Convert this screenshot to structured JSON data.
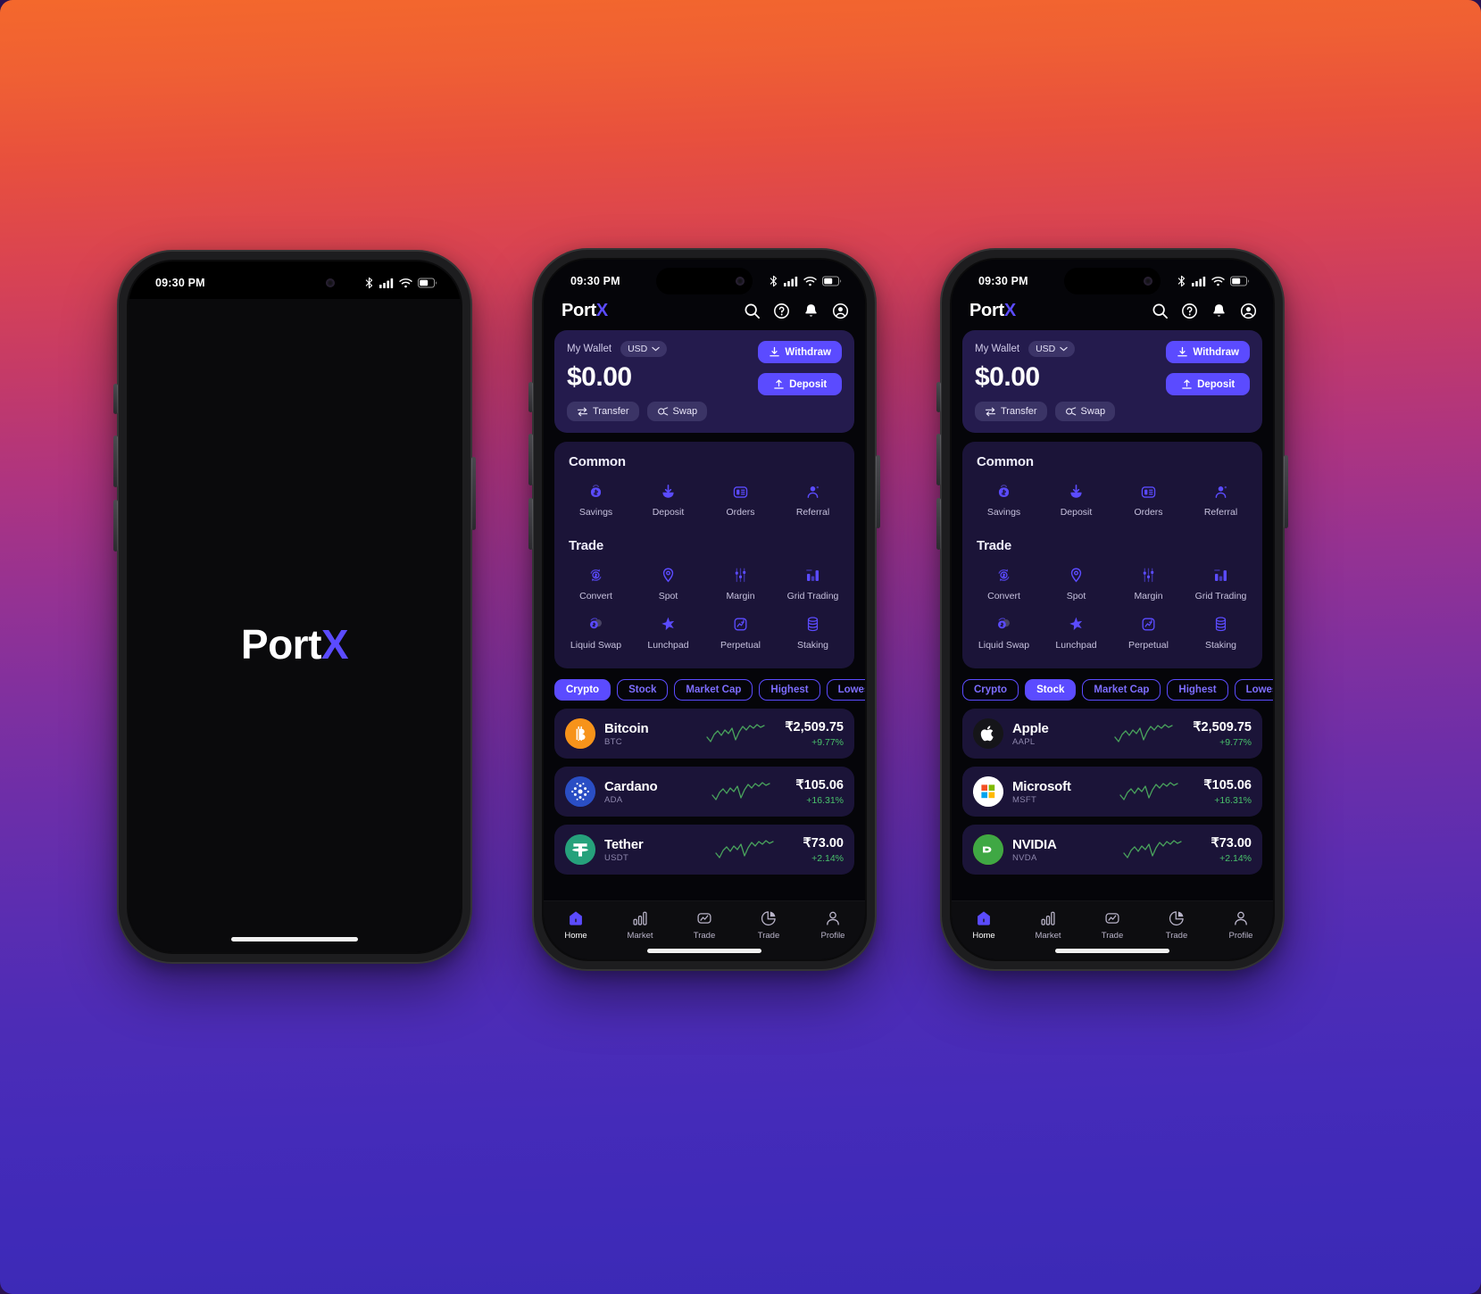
{
  "scene": {
    "background_gradient_top": "#f4682c",
    "background_gradient_mid": "#963292",
    "background_gradient_bottom": "#3b29b5",
    "accent_color": "#5b4bff",
    "card_color": "#1b1438",
    "wallet_card_color": "#241b4d",
    "positive_color": "#49c16b"
  },
  "status_bar": {
    "time": "09:30 PM"
  },
  "splash": {
    "logo_prefix": "Port",
    "logo_accent": "X"
  },
  "header": {
    "logo_prefix": "Port",
    "logo_accent": "X",
    "icons": [
      "search-icon",
      "help-circle-icon",
      "bell-icon",
      "account-circle-icon"
    ]
  },
  "wallet": {
    "label": "My Wallet",
    "currency": "USD",
    "balance": "$0.00",
    "withdraw_label": "Withdraw",
    "deposit_label": "Deposit",
    "transfer_label": "Transfer",
    "swap_label": "Swap"
  },
  "menu": {
    "common_title": "Common",
    "common_items": [
      {
        "label": "Savings",
        "icon": "savings-bag-icon"
      },
      {
        "label": "Deposit",
        "icon": "deposit-arrow-icon"
      },
      {
        "label": "Orders",
        "icon": "orders-receipt-icon"
      },
      {
        "label": "Referral",
        "icon": "referral-person-icon"
      }
    ],
    "trade_title": "Trade",
    "trade_items": [
      {
        "label": "Convert",
        "icon": "convert-refresh-icon"
      },
      {
        "label": "Spot",
        "icon": "spot-pin-icon"
      },
      {
        "label": "Margin",
        "icon": "margin-sliders-icon"
      },
      {
        "label": "Grid Trading",
        "icon": "grid-bars-icon"
      },
      {
        "label": "Liquid Swap",
        "icon": "liquid-swap-icon"
      },
      {
        "label": "Lunchpad",
        "icon": "lunchpad-star-icon"
      },
      {
        "label": "Perpetual",
        "icon": "perpetual-chart-icon"
      },
      {
        "label": "Staking",
        "icon": "staking-coins-icon"
      }
    ]
  },
  "filters_crypto": [
    {
      "label": "Crypto",
      "active": true
    },
    {
      "label": "Stock",
      "active": false
    },
    {
      "label": "Market Cap",
      "active": false
    },
    {
      "label": "Highest",
      "active": false
    },
    {
      "label": "Lowest",
      "active": false
    }
  ],
  "filters_stock": [
    {
      "label": "Crypto",
      "active": false
    },
    {
      "label": "Stock",
      "active": true
    },
    {
      "label": "Market Cap",
      "active": false
    },
    {
      "label": "Highest",
      "active": false
    },
    {
      "label": "Lowest",
      "active": false
    }
  ],
  "crypto_assets": [
    {
      "name": "Bitcoin",
      "symbol": "BTC",
      "price": "₹2,509.75",
      "change": "+9.77%",
      "logo": "bitcoin-logo",
      "logo_bg": "#f7931a",
      "logo_glyph": "₿"
    },
    {
      "name": "Cardano",
      "symbol": "ADA",
      "price": "₹105.06",
      "change": "+16.31%",
      "logo": "cardano-logo",
      "logo_bg": "#2a4ec4",
      "logo_glyph": "✵"
    },
    {
      "name": "Tether",
      "symbol": "USDT",
      "price": "₹73.00",
      "change": "+2.14%",
      "logo": "tether-logo",
      "logo_bg": "#26a17b",
      "logo_glyph": "₮"
    }
  ],
  "stock_assets": [
    {
      "name": "Apple",
      "symbol": "AAPL",
      "price": "₹2,509.75",
      "change": "+9.77%",
      "logo": "apple-logo",
      "logo_bg": "#1b1b1f",
      "logo_glyph": ""
    },
    {
      "name": "Microsoft",
      "symbol": "MSFT",
      "price": "₹105.06",
      "change": "+16.31%",
      "logo": "microsoft-logo",
      "logo_bg": "#ffffff",
      "logo_glyph": ""
    },
    {
      "name": "NVIDIA",
      "symbol": "NVDA",
      "price": "₹73.00",
      "change": "+2.14%",
      "logo": "nvidia-logo",
      "logo_bg": "#76b900",
      "logo_glyph": ""
    }
  ],
  "bottom_nav": [
    {
      "label": "Home",
      "icon": "home-icon",
      "active": true
    },
    {
      "label": "Market",
      "icon": "bars-icon",
      "active": false
    },
    {
      "label": "Trade",
      "icon": "trend-icon",
      "active": false
    },
    {
      "label": "Trade",
      "icon": "pie-icon",
      "active": false
    },
    {
      "label": "Profile",
      "icon": "person-icon",
      "active": false
    }
  ]
}
